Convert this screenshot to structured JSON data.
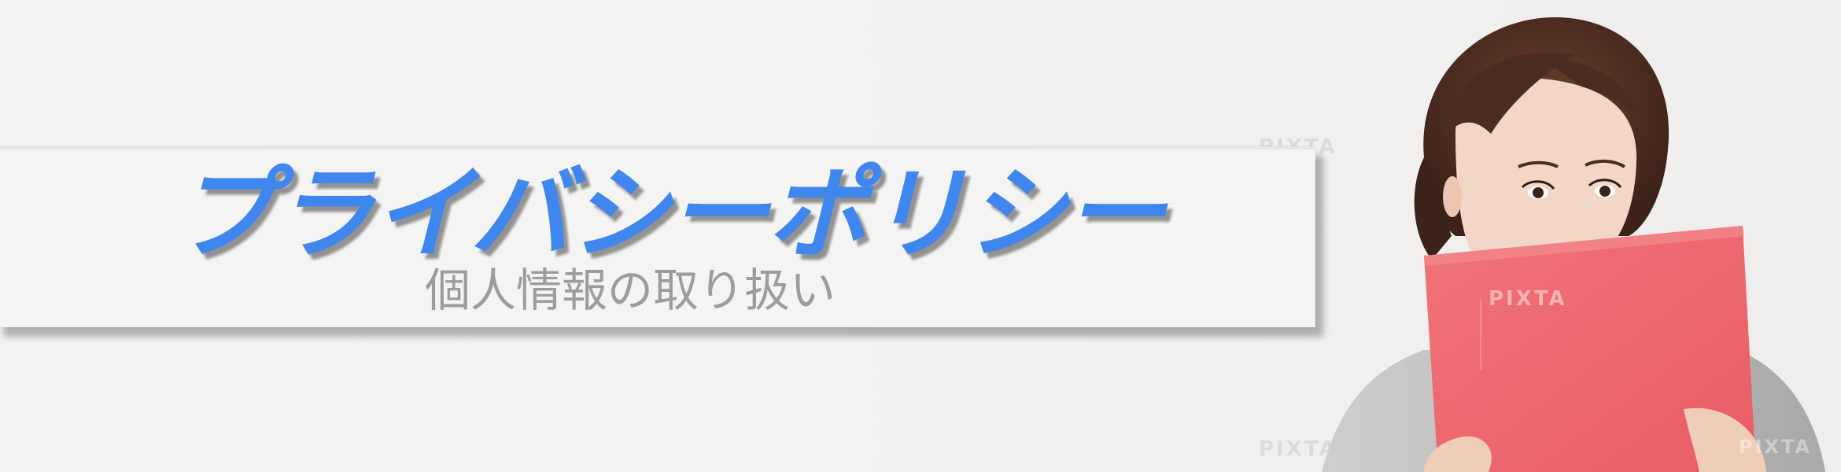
{
  "banner": {
    "title": "プライバシーポリシー",
    "subtitle": "個人情報の取り扱い"
  },
  "photo": {
    "watermark": "PIXTA",
    "colors": {
      "folder": "#ee6a6f",
      "hair": "#4a2c20",
      "skin": "#f3d7c6",
      "sweater": "#b9b9b7"
    }
  },
  "colors": {
    "title": "#3f86ee",
    "subtitle": "#9c9c9c",
    "panel": "#f4f4f3",
    "background": "#f2f1ef"
  }
}
